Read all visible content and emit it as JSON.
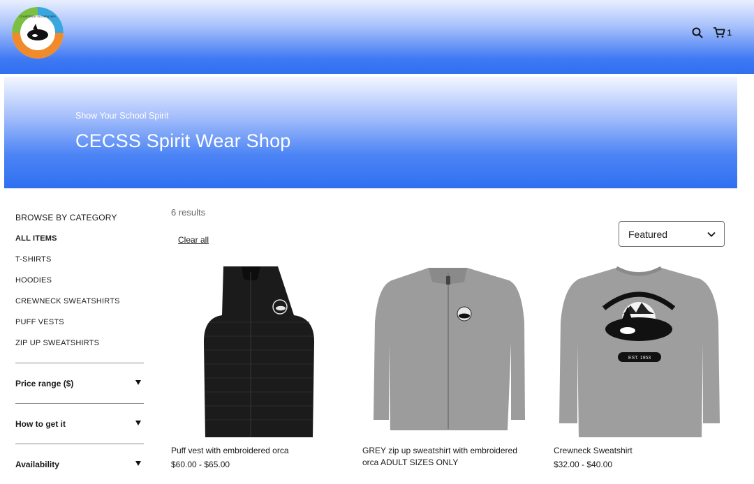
{
  "header": {
    "logo_alt": "Courtenay Elementary Care for the world Care for others Care for self logo",
    "cart_count": "1"
  },
  "hero": {
    "subtitle": "Show Your School Spirit",
    "title": "CECSS Spirit Wear Shop"
  },
  "sidebar": {
    "heading": "BROWSE BY CATEGORY",
    "categories": [
      "ALL ITEMS",
      "T-SHIRTS",
      "HOODIES",
      "CREWNECK SWEATSHIRTS",
      "PUFF VESTS",
      "ZIP UP SWEATSHIRTS"
    ],
    "filters": [
      "Price range ($)",
      "How to get it",
      "Availability"
    ]
  },
  "listing": {
    "results": "6 results",
    "clear_all": "Clear all",
    "sort_value": "Featured"
  },
  "products": [
    {
      "name": "Puff vest with embroidered orca",
      "price": "$60.00 - $65.00",
      "line2": ""
    },
    {
      "name": "GREY zip up sweatshirt with embroidered",
      "line2": "orca ADULT SIZES ONLY",
      "price": ""
    },
    {
      "name": "Crewneck Sweatshirt",
      "price": "$32.00 - $40.00",
      "line2": ""
    }
  ],
  "colors": {
    "accent_blue": "#2f6ff0",
    "text": "#1a1a1a"
  },
  "icons": [
    "search-icon",
    "cart-icon",
    "chevron-down-icon",
    "triangle-down-icon"
  ]
}
